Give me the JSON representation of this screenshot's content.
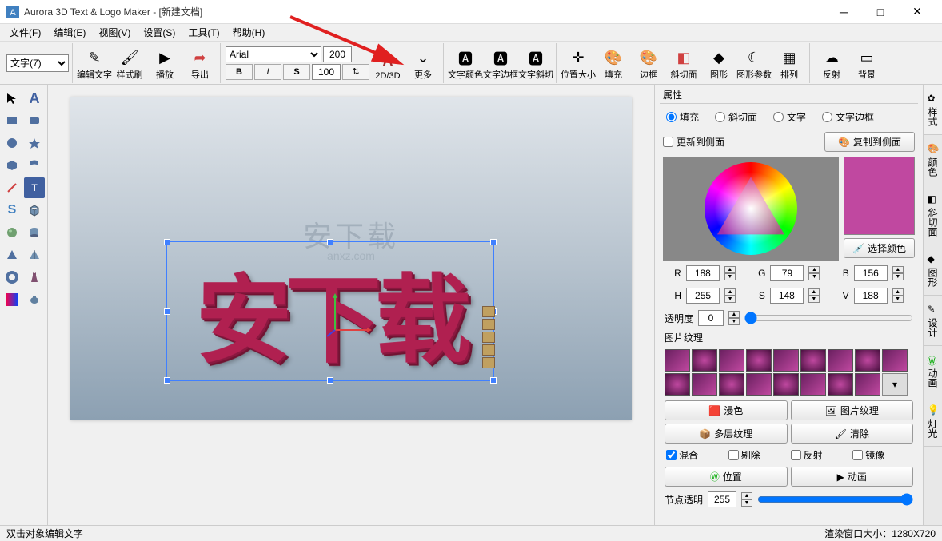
{
  "title": "Aurora 3D Text & Logo Maker - [新建文档]",
  "menu": [
    "文件(F)",
    "编辑(E)",
    "视图(V)",
    "设置(S)",
    "工具(T)",
    "帮助(H)"
  ],
  "toolbar": {
    "text_select": "文字(7)",
    "edit_text": "编辑文字",
    "format_brush": "样式刷",
    "play": "播放",
    "export": "导出",
    "font": "Arial",
    "size1": "200",
    "size2": "100",
    "bold": "B",
    "italic": "I",
    "strike": "S",
    "toggle23d": "2D/3D",
    "more": "更多",
    "text_color": "文字颜色",
    "text_border": "文字边框",
    "text_bevel": "文字斜切",
    "pos_size": "位置大小",
    "fill": "填充",
    "border": "边框",
    "bevel": "斜切面",
    "shape": "图形",
    "shape_param": "图形参数",
    "arrange": "排列",
    "reflect": "反射",
    "background": "背景"
  },
  "canvas": {
    "watermark": "安下载",
    "watermark_sub": "anxz.com",
    "text3d": "安下载"
  },
  "props": {
    "title": "属性",
    "r_fill": "填充",
    "r_bevel": "斜切面",
    "r_text": "文字",
    "r_textborder": "文字边框",
    "update_side": "更新到侧面",
    "copy_side": "复制到侧面",
    "pick_color": "选择颜色",
    "R": "R",
    "G": "G",
    "B": "B",
    "H": "H",
    "S": "S",
    "V": "V",
    "r_val": "188",
    "g_val": "79",
    "b_val": "156",
    "h_val": "255",
    "s_val": "148",
    "v_val": "188",
    "opacity": "透明度",
    "opacity_val": "0",
    "img_tex": "图片纹理",
    "gradient": "漫色",
    "img_tex_btn": "图片纹理",
    "multi_tex": "多层纹理",
    "clear": "清除",
    "mix": "混合",
    "erase": "剔除",
    "reflect": "反射",
    "mirror": "镜像",
    "position": "位置",
    "animation": "动画",
    "node_opacity": "节点透明",
    "node_opacity_val": "255"
  },
  "side_tabs": [
    "样式",
    "颜色",
    "斜切面",
    "图形",
    "设计",
    "动画",
    "灯光"
  ],
  "status": {
    "left": "双击对象编辑文字",
    "right": "渲染窗口大小：1280X720"
  }
}
